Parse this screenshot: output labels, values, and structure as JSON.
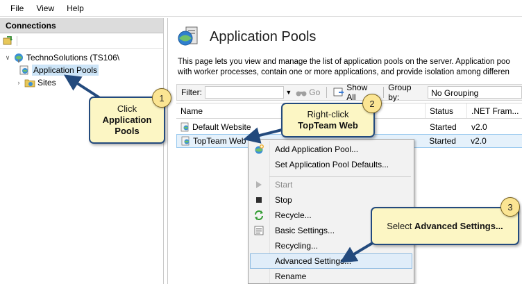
{
  "menubar": {
    "items": [
      "File",
      "View",
      "Help"
    ]
  },
  "connections": {
    "header": "Connections",
    "tree": {
      "server": "TechnoSolutions (TS106\\",
      "app_pools": "Application Pools",
      "sites": "Sites"
    }
  },
  "page": {
    "title": "Application Pools",
    "description_line1": "This page lets you view and manage the list of application pools on the server. Application poo",
    "description_line2": "with worker processes, contain one or more applications, and provide isolation among differen"
  },
  "filter_bar": {
    "filter_label": "Filter:",
    "go_label": "Go",
    "show_all_label": "Show All",
    "group_by_label": "Group by:",
    "group_by_value": "No Grouping"
  },
  "grid": {
    "columns": {
      "name": "Name",
      "status": "Status",
      "net": ".NET Fram..."
    },
    "rows": [
      {
        "name": "Default Website",
        "status": "Started",
        "net": "v2.0"
      },
      {
        "name": "TopTeam Web",
        "status": "Started",
        "net": "v2.0"
      }
    ]
  },
  "context_menu": {
    "add_pool": "Add Application Pool...",
    "set_defaults": "Set Application Pool Defaults...",
    "start": "Start",
    "stop": "Stop",
    "recycle": "Recycle...",
    "basic_settings": "Basic Settings...",
    "recycling": "Recycling...",
    "advanced_settings": "Advanced Settings...",
    "rename": "Rename"
  },
  "callouts": {
    "c1": {
      "num": "1",
      "line1": "Click",
      "line2": "Application",
      "line3": "Pools"
    },
    "c2": {
      "num": "2",
      "line1": "Right-click",
      "line2": "TopTeam Web"
    },
    "c3": {
      "num": "3",
      "prefix": "Select ",
      "bold": "Advanced Settings..."
    }
  },
  "colors": {
    "callout_fill": "#fcf6c4",
    "callout_border": "#234a7d",
    "badge_fill": "#fbe593",
    "selection": "#cce4f7"
  }
}
